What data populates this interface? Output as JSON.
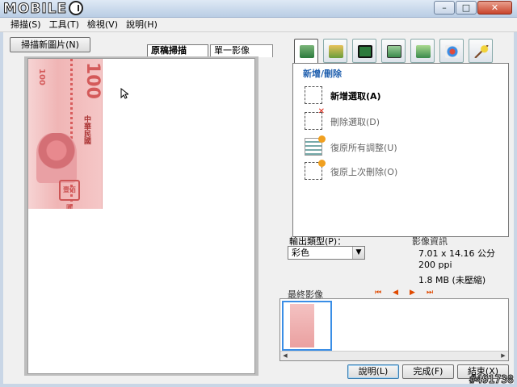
{
  "window": {
    "logo_text": "MOBILE",
    "buttons": {
      "minimize": "–",
      "maximize": "□",
      "close": "✕"
    }
  },
  "menu": [
    "掃描(S)",
    "工具(T)",
    "檢視(V)",
    "說明(H)"
  ],
  "scan_button": "掃描新圖片(N)",
  "tabs": [
    "原稿掃描",
    "單一影像"
  ],
  "banknote": {
    "value": "100",
    "small_value": "100",
    "chars": "中華民國",
    "seal": "壹佰圓"
  },
  "tool_icons": [
    "select-tool",
    "image-adjust",
    "crop",
    "resize",
    "rotate",
    "color-balance",
    "magic-wand"
  ],
  "panel": {
    "title": "新增/刪除",
    "actions": [
      "新增選取(A)",
      "刪除選取(D)",
      "復原所有調整(U)",
      "復原上次刪除(O)"
    ]
  },
  "output": {
    "label": "輸出類型(P)：",
    "value": "彩色"
  },
  "image_info": {
    "label": "影像資訊",
    "size": "7.01 x 14.16 公分",
    "dpi": "200 ppi",
    "filesize": "1.8 MB (未壓縮)"
  },
  "final_image_label": "最終影像",
  "nav": [
    "⏮",
    "◀",
    "▶",
    "⏭"
  ],
  "buttons": {
    "help": "說明(L)",
    "done": "完成(F)",
    "end": "結束(X)"
  },
  "watermark": "#491738",
  "colors": {
    "accent": "#1f5fae",
    "nav": "#e04a00"
  }
}
